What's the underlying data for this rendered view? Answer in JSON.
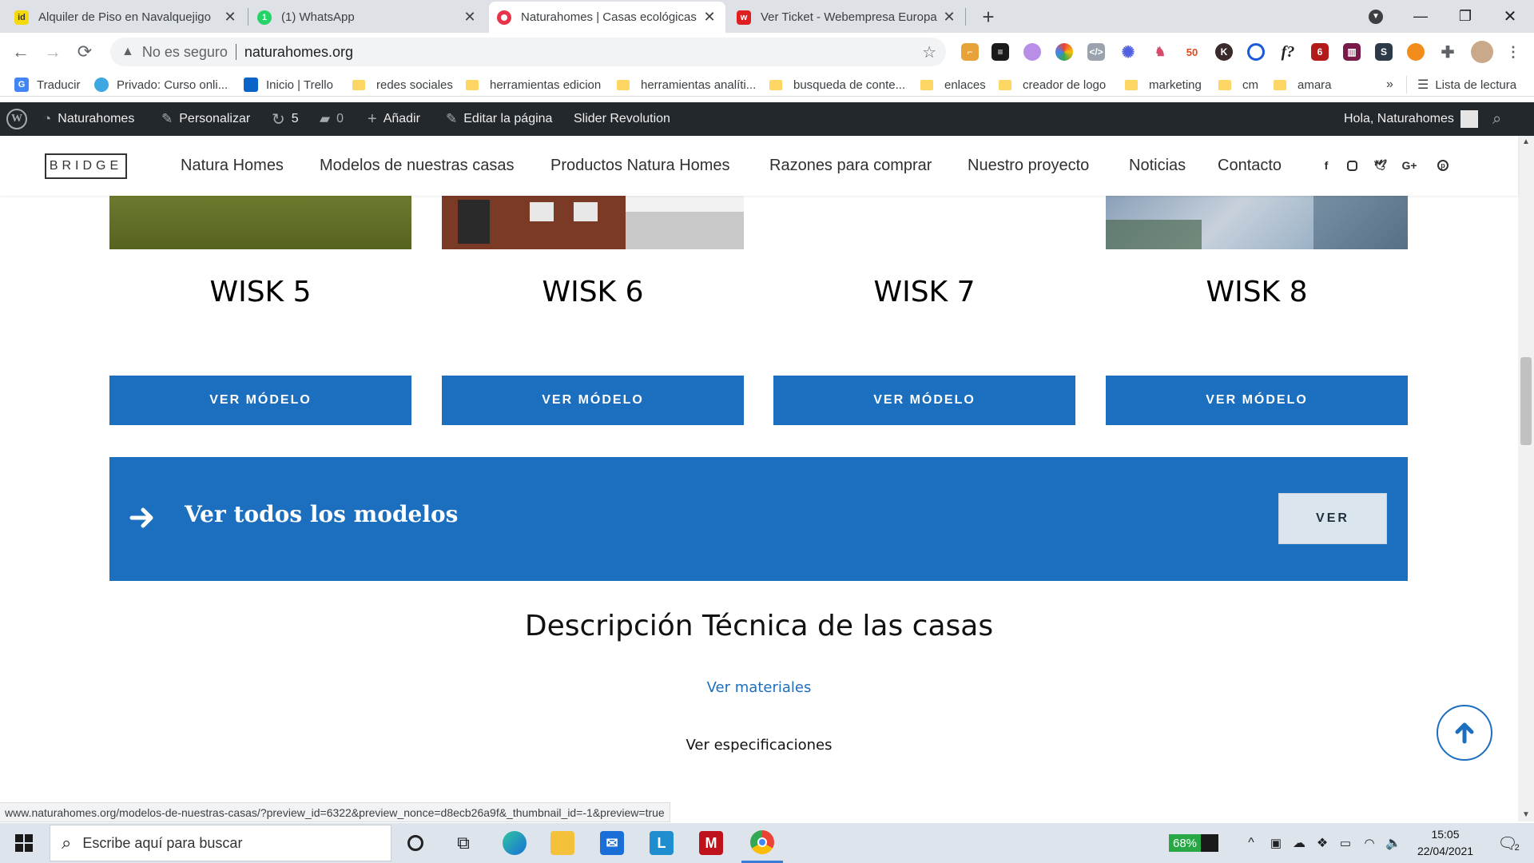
{
  "browser": {
    "tabs": [
      {
        "title": "Alquiler de Piso en Navalquejigo",
        "favicon_text": "id",
        "favicon_color": "#a6c33c"
      },
      {
        "title": "(1) WhatsApp",
        "favicon_text": "1",
        "favicon_color": "#25d366"
      },
      {
        "title": "Naturahomes | Casas ecológicas",
        "favicon_text": "",
        "favicon_color": "#e8334a"
      },
      {
        "title": "Ver Ticket - Webempresa Europa",
        "favicon_text": "w",
        "favicon_color": "#e02020"
      }
    ],
    "new_tab_icon": "plus-icon",
    "omnibox": {
      "security_label": "No es seguro",
      "url": "naturahomes.org"
    },
    "bookmarks": [
      {
        "label": "Traducir",
        "type": "app",
        "color": "#4285f4",
        "icon_text": "G"
      },
      {
        "label": "Privado: Curso onli...",
        "type": "app",
        "color": "#3ea6e0",
        "icon_text": ""
      },
      {
        "label": "Inicio | Trello",
        "type": "app",
        "color": "#0a63c9",
        "icon_text": ""
      },
      {
        "label": "redes sociales",
        "type": "folder"
      },
      {
        "label": "herramientas edicion",
        "type": "folder"
      },
      {
        "label": "herramientas analíti...",
        "type": "folder"
      },
      {
        "label": "busqueda de conte...",
        "type": "folder"
      },
      {
        "label": "enlaces",
        "type": "folder"
      },
      {
        "label": "creador de logo",
        "type": "folder"
      },
      {
        "label": "marketing",
        "type": "folder"
      },
      {
        "label": "cm",
        "type": "folder"
      },
      {
        "label": "amara",
        "type": "folder"
      }
    ],
    "bookmarks_overflow": "»",
    "reading_list": "Lista de lectura",
    "status_url": "www.naturahomes.org/modelos-de-nuestras-casas/?preview_id=6322&preview_nonce=d8ecb26a9f&_thumbnail_id=-1&preview=true"
  },
  "wp_admin_bar": {
    "site_name": "Naturahomes",
    "customize": "Personalizar",
    "updates_count": "5",
    "comments_count": "0",
    "add_new": "Añadir",
    "edit_page": "Editar la página",
    "slider": "Slider Revolution",
    "greeting": "Hola, Naturahomes"
  },
  "site": {
    "logo": "BRIDGE",
    "menu": [
      "Natura Homes",
      "Modelos de nuestras casas",
      "Productos Natura Homes",
      "Razones para comprar",
      "Nuestro proyecto",
      "Noticias",
      "Contacto"
    ],
    "social_icons": [
      "facebook-icon",
      "instagram-icon",
      "twitter-icon",
      "google-plus-icon",
      "pinterest-icon"
    ]
  },
  "models": [
    {
      "name": "WISK 5",
      "button": "VER MÓDELO"
    },
    {
      "name": "WISK 6",
      "button": "VER MÓDELO"
    },
    {
      "name": "WISK 7",
      "button": "VER MÓDELO"
    },
    {
      "name": "WISK 8",
      "button": "VER MÓDELO"
    }
  ],
  "cta": {
    "text": "Ver todos los modelos",
    "button": "VER"
  },
  "tech_section": {
    "title": "Descripción Técnica de las casas",
    "materials_link": "Ver materiales",
    "specs_link": "Ver especificaciones"
  },
  "taskbar": {
    "search_placeholder": "Escribe aquí para buscar",
    "battery_percent": "68%",
    "time": "15:05",
    "date": "22/04/2021",
    "notifications_count": "2"
  },
  "colors": {
    "accent_blue": "#1c6ebf",
    "wp_bar": "#23282d"
  }
}
